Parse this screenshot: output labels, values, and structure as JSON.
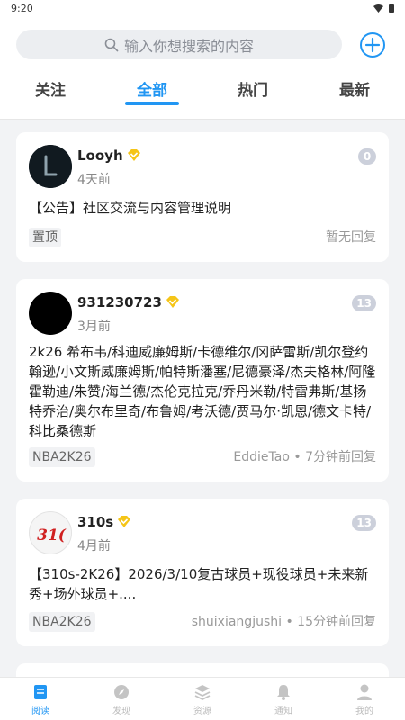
{
  "status": {
    "time": "9:20"
  },
  "search": {
    "placeholder": "输入你想搜索的内容"
  },
  "tabs": [
    {
      "label": "关注"
    },
    {
      "label": "全部",
      "active": true
    },
    {
      "label": "热门"
    },
    {
      "label": "最新"
    }
  ],
  "posts": [
    {
      "author": "Looyh",
      "time": "4天前",
      "count": "0",
      "text": "【公告】社区交流与内容管理说明",
      "tag": "置顶",
      "reply": "暂无回复"
    },
    {
      "author": "931230723",
      "time": "3月前",
      "count": "13",
      "text": "2k26 希布韦/科迪威廉姆斯/卡德维尔/冈萨雷斯/凯尔登约翰逊/小文斯威廉姆斯/帕特斯潘塞/尼德豪泽/杰夫格林/阿隆霍勒迪/朱赞/海兰德/杰伦克拉克/乔丹米勒/特雷弗斯/基扬特乔治/奥尔布里奇/布鲁姆/考沃德/贾马尔·凯恩/德文卡特/科比桑德斯",
      "tag": "NBA2K26",
      "reply": "EddieTao • 7分钟前回复"
    },
    {
      "author": "310s",
      "time": "4月前",
      "count": "13",
      "avatar_text": "31(",
      "text": "【310s-2K26】2026/3/10复古球员+现役球员+未来新秀+场外球员+....",
      "tag": "NBA2K26",
      "reply": "shuixiangjushi • 15分钟前回复"
    }
  ],
  "nav": [
    {
      "label": "阅读",
      "icon": "book-icon",
      "active": true
    },
    {
      "label": "发现",
      "icon": "compass-icon"
    },
    {
      "label": "资源",
      "icon": "layers-icon"
    },
    {
      "label": "通知",
      "icon": "bell-icon"
    },
    {
      "label": "我的",
      "icon": "user-icon"
    }
  ],
  "colors": {
    "accent": "#2196f3",
    "badge": "#ccd0db",
    "verified": "#f5c518"
  }
}
